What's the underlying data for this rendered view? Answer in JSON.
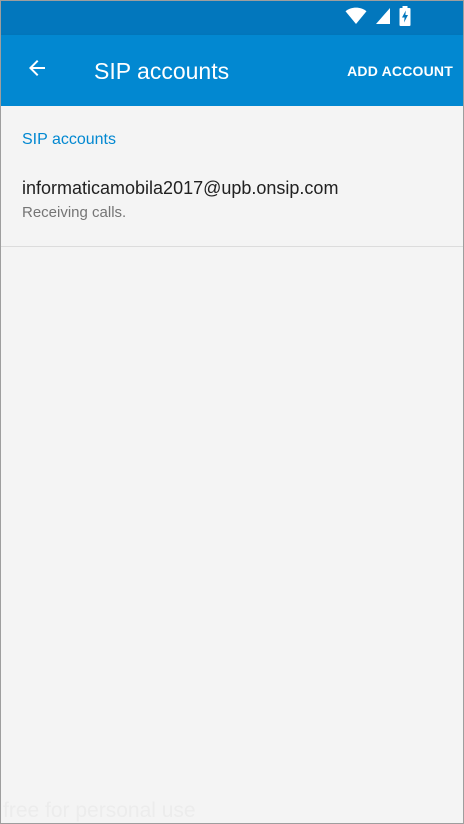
{
  "status_bar": {
    "icons": [
      "wifi-icon",
      "cell-signal-icon",
      "battery-charging-icon"
    ]
  },
  "app_bar": {
    "back_icon": "arrow-back-icon",
    "title": "SIP accounts",
    "action_label": "ADD ACCOUNT"
  },
  "content": {
    "section_header": "SIP accounts",
    "accounts": [
      {
        "title": "informaticamobila2017@upb.onsip.com",
        "summary": "Receiving calls."
      }
    ]
  },
  "watermark": "free for personal use",
  "colors": {
    "status_bar": "#0277bd",
    "app_bar": "#0288d1",
    "accent": "#0288d1",
    "background": "#f4f4f4"
  }
}
